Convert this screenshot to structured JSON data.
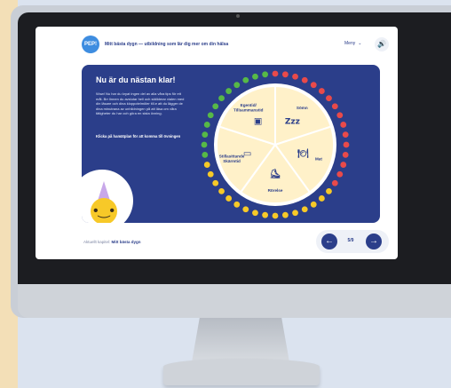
{
  "app": {
    "logo_text": "PEP!",
    "title": "Mitt bästa dygn — utbildning som lär dig mer om din hälsa"
  },
  "toolbar": {
    "menu_label": "Meny",
    "menu_icon": "chevron-down-icon",
    "sound_icon": "speaker-icon"
  },
  "panel": {
    "heading": "Nu är du nästan klar!",
    "body": "Wow! Nu har du kryat ingen del av alla våra tips för ett mål. Brr linnen du avslutar hell och ställderar vialen med din läsare och dina kloppotelmöler till.e att du lägger de dina minutrana av unhildningen på att läsa om våra tätigheter du har och göra en sista övning.",
    "cta": "Klicka på hamätplan för att komma till övningen"
  },
  "wheel": {
    "segments": [
      {
        "label": "Sömn",
        "color": "#fff1c9",
        "icon": "zzz-icon"
      },
      {
        "label": "Mat",
        "color": "#fff1c9",
        "icon": "food-icon"
      },
      {
        "label": "Rörelse",
        "color": "#fff1c9",
        "icon": "roller-skate-icon"
      },
      {
        "label": "Stillasittande Skärmtid",
        "color": "#fff1c9",
        "icon": "tablet-icon"
      },
      {
        "label": "Egentid/ Tillsammanstid",
        "color": "#fff1c9",
        "icon": "speaker-icon"
      }
    ],
    "ring_colors": [
      "#e84a4a",
      "#f7c928",
      "#57b947"
    ]
  },
  "side_button_icon": "lightning-icon",
  "footer": {
    "prefix": "Aktuellt kapitel:",
    "chapter": "Mitt bästa dygn"
  },
  "pager": {
    "current": "5/9"
  },
  "colors": {
    "primary": "#2b3e8a",
    "accent_yellow": "#f7c928",
    "accent_red": "#e84a4a",
    "accent_green": "#57b947"
  }
}
